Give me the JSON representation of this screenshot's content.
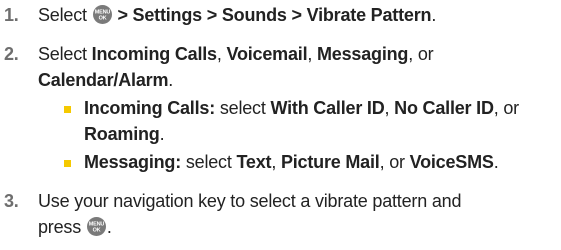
{
  "icons": {
    "menu_ok_key": "menu-ok-key-icon",
    "menu_ok_top": "MENU",
    "menu_ok_bottom": "OK"
  },
  "colors": {
    "bullet": "#f5c900",
    "step_number": "#6e6e6e",
    "text": "#222222"
  },
  "steps": [
    {
      "number": "1.",
      "parts": {
        "a": "Select ",
        "b": " > Settings > Sounds > Vibrate Pattern",
        "c": "."
      }
    },
    {
      "number": "2.",
      "parts": {
        "a": "Select ",
        "b": "Incoming Calls",
        "c": ", ",
        "d": "Voicemail",
        "e": ", ",
        "f": "Messaging",
        "g": ", or",
        "h": "Calendar/Alarm",
        "i": "."
      },
      "subitems": [
        {
          "label": "Incoming Calls:",
          "a": " select ",
          "b": "With Caller ID",
          "c": ", ",
          "d": "No Caller ID",
          "e": ", or",
          "f": "Roaming",
          "g": "."
        },
        {
          "label": "Messaging:",
          "a": " select ",
          "b": "Text",
          "c": ", ",
          "d": "Picture Mail",
          "e": ", or ",
          "f": "VoiceSMS",
          "g": "."
        }
      ]
    },
    {
      "number": "3.",
      "parts": {
        "a": "Use your navigation key to select a vibrate pattern and",
        "b": "press ",
        "c": "."
      }
    }
  ]
}
